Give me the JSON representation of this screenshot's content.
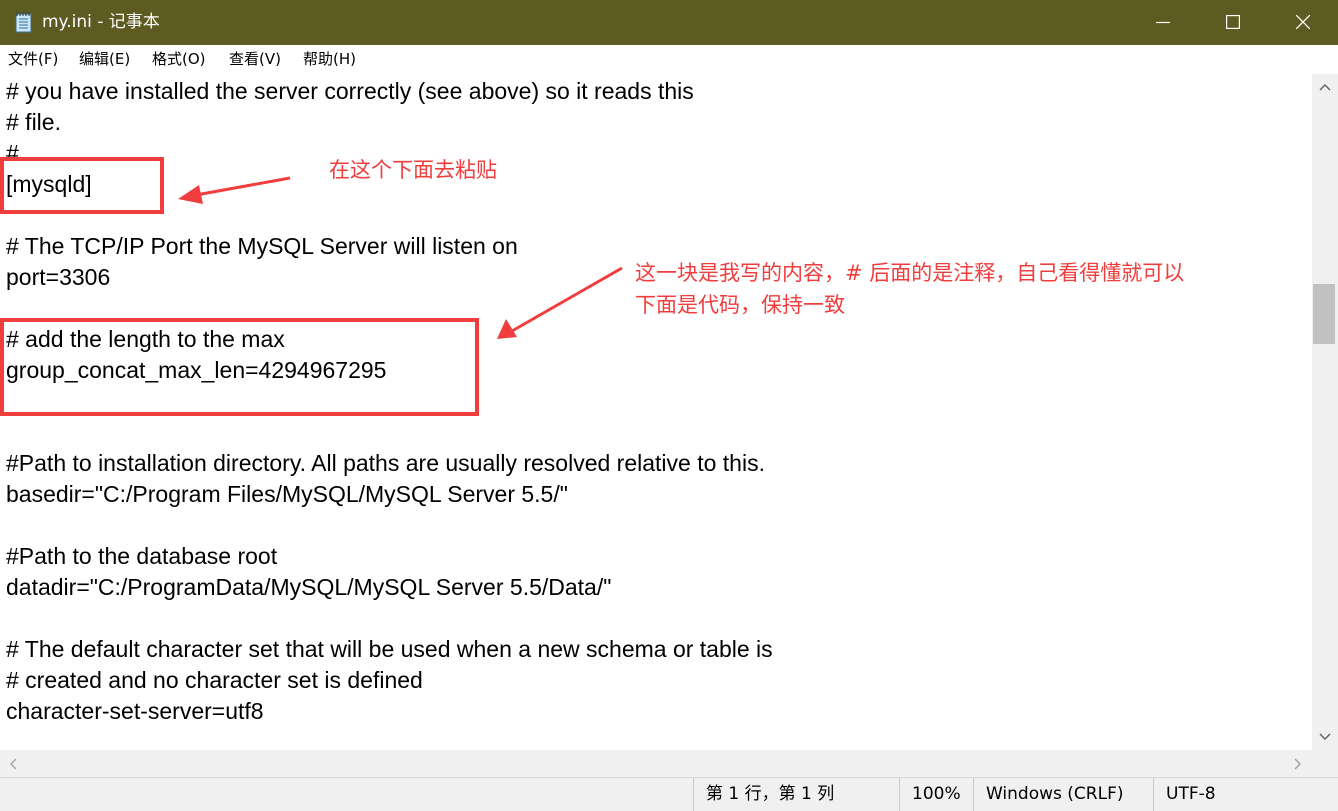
{
  "window": {
    "title": "my.ini - 记事本",
    "icon": "notepad-icon"
  },
  "menu": [
    "文件(F)",
    "编辑(E)",
    "格式(O)",
    "查看(V)",
    "帮助(H)"
  ],
  "editor_lines": [
    "# you have installed the server correctly (see above) so it reads this",
    "# file.",
    "#",
    "[mysqld]",
    "",
    "# The TCP/IP Port the MySQL Server will listen on",
    "port=3306",
    "",
    "# add the length to the max",
    "group_concat_max_len=4294967295",
    "",
    "",
    "#Path to installation directory. All paths are usually resolved relative to this.",
    "basedir=\"C:/Program Files/MySQL/MySQL Server 5.5/\"",
    "",
    "#Path to the database root",
    "datadir=\"C:/ProgramData/MySQL/MySQL Server 5.5/Data/\"",
    "",
    "# The default character set that will be used when a new schema or table is",
    "# created and no character set is defined",
    "character-set-server=utf8"
  ],
  "annotations": {
    "note1": "在这个下面去粘贴",
    "note2_line1": "这一块是我写的内容，# 后面的是注释，自己看得懂就可以",
    "note2_line2": "下面是代码，保持一致",
    "color": "#f03d3d"
  },
  "status": {
    "position": "第 1 行，第 1 列",
    "zoom": "100%",
    "line_ending": "Windows (CRLF)",
    "encoding": "UTF-8"
  },
  "colors": {
    "titlebar": "#5d5a22",
    "annotation": "#f03d3d"
  }
}
